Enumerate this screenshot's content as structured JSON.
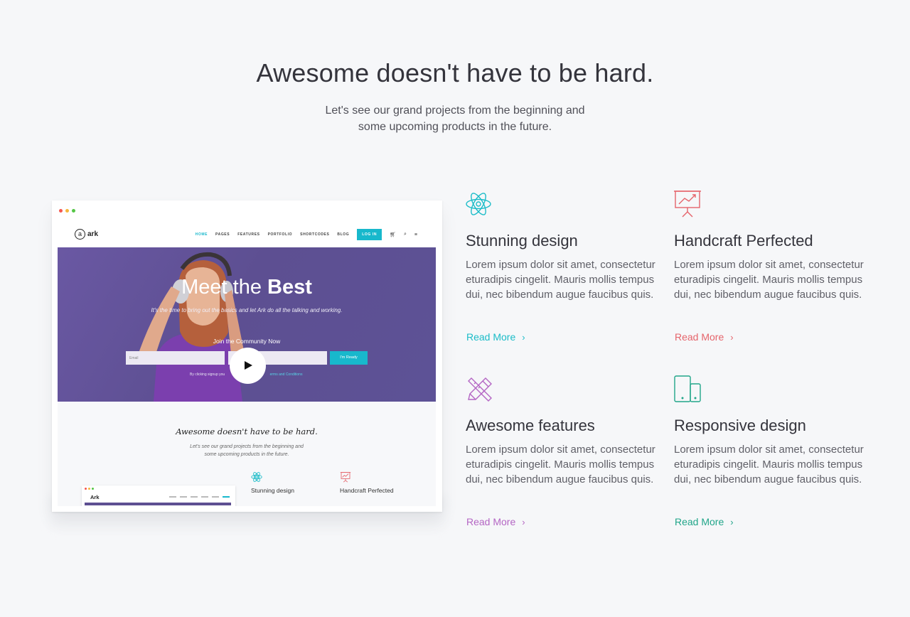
{
  "hero": {
    "title": "Awesome doesn't have to be hard.",
    "subtitle_line1": "Let's see our grand projects from the beginning and",
    "subtitle_line2": "some upcoming products in the future."
  },
  "mockup": {
    "logo_letter": "a",
    "logo_text": "ark",
    "nav": [
      "HOME",
      "PAGES",
      "FEATURES",
      "PORTFOLIO",
      "SHORTCODES",
      "BLOG"
    ],
    "login_label": "LOG IN",
    "banner": {
      "title_light": "Meet the ",
      "title_bold": "Best",
      "description": "It's the time to bring out the basics and let Ark do all the talking and working.",
      "community": "Join the Community Now",
      "email_placeholder": "Email",
      "button_label": "I'm Ready",
      "terms_prefix": "By clicking signup you",
      "terms_link": "erms and Conditions"
    },
    "section": {
      "title": "Awesome doesn't have to be hard.",
      "subtitle_line1": "Let's see our grand projects from the beginning and",
      "subtitle_line2": "some upcoming products in the future.",
      "mini_logo": "Ark",
      "mini_features": [
        "Stunning design",
        "Handcraft Perfected"
      ]
    },
    "window_dots": [
      "#f5574e",
      "#f6b73d",
      "#54c645"
    ]
  },
  "features": [
    {
      "icon": "atom-icon",
      "color": "#1bbcc8",
      "title": "Stunning design",
      "text": "Lorem ipsum dolor sit amet, consectetur eturadipis cingelit. Mauris mollis tempus dui, nec bibendum augue faucibus quis.",
      "link": "Read More"
    },
    {
      "icon": "presentation-chart-icon",
      "color": "#e5646b",
      "title": "Handcraft Perfected",
      "text": "Lorem ipsum dolor sit amet, consectetur eturadipis cingelit. Mauris mollis tempus dui, nec bibendum augue faucibus quis.",
      "link": "Read More"
    },
    {
      "icon": "pencil-ruler-icon",
      "color": "#b466c4",
      "title": "Awesome features",
      "text": "Lorem ipsum dolor sit amet, consectetur eturadipis cingelit. Mauris mollis tempus dui, nec bibendum augue faucibus quis.",
      "link": "Read More"
    },
    {
      "icon": "devices-icon",
      "color": "#20a589",
      "title": "Responsive design",
      "text": "Lorem ipsum dolor sit amet, consectetur eturadipis cingelit. Mauris mollis tempus dui, nec bibendum augue faucibus quis.",
      "link": "Read More"
    }
  ]
}
